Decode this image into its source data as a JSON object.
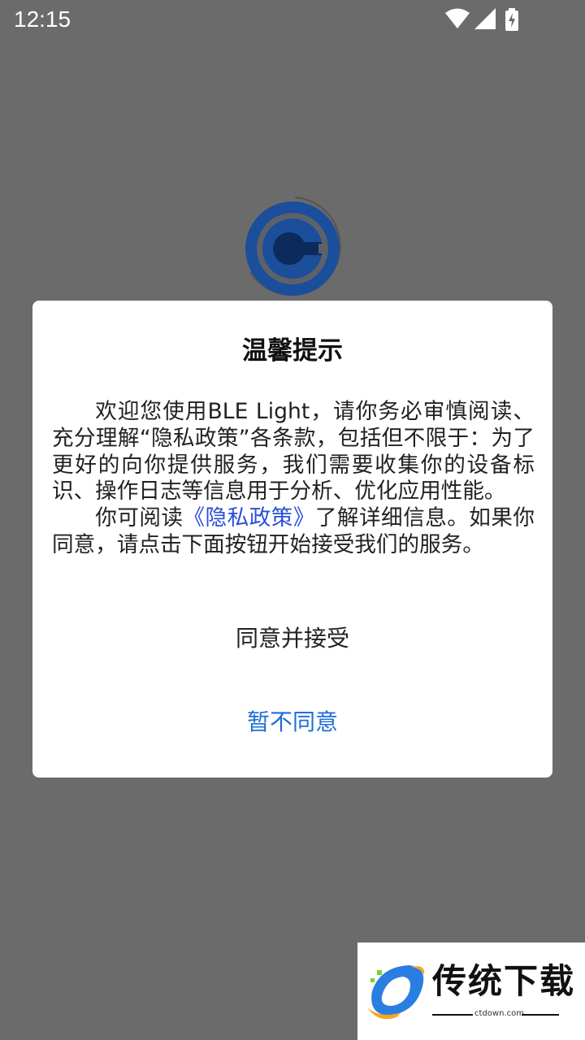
{
  "status_bar": {
    "time": "12:15",
    "icons": [
      "wifi-icon",
      "signal-icon",
      "battery-charging-icon"
    ]
  },
  "app": {
    "logo_icon": "light-bulb-logo-icon",
    "logo_color": "#1b4e9b"
  },
  "dialog": {
    "title": "温馨提示",
    "paragraph1": "欢迎您使用BLE Light，请你务必审慎阅读、充分理解“隐私政策”各条款，包括但不限于：为了更好的向你提供服务，我们需要收集你的设备标识、操作日志等信息用于分析、优化应用性能。",
    "paragraph2_before": "你可阅读",
    "privacy_link": "《隐私政策》",
    "paragraph2_after": "了解详细信息。如果你同意，请点击下面按钮开始接受我们的服务。",
    "agree_label": "同意并接受",
    "disagree_label": "暂不同意",
    "link_color": "#2a4fd8",
    "disagree_color": "#1e6ed8"
  },
  "watermark": {
    "name": "传统下载",
    "domain": "ctdown.com"
  }
}
